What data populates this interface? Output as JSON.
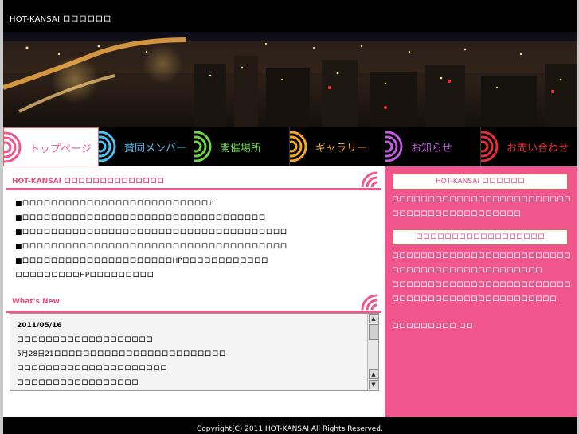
{
  "header": {
    "site_title": "HOT-KANSAI ロロロロロロ"
  },
  "nav": {
    "items": [
      {
        "label": "トップページ",
        "color": "#f0558b",
        "active": true
      },
      {
        "label": "賛同メンバー",
        "color": "#4fc0ef",
        "active": false
      },
      {
        "label": "開催場所",
        "color": "#6fd24a",
        "active": false
      },
      {
        "label": "ギャラリー",
        "color": "#f5a623",
        "active": false
      },
      {
        "label": "お知らせ",
        "color": "#c05ce0",
        "active": false
      },
      {
        "label": "お問い合わせ",
        "color": "#e83030",
        "active": false
      }
    ]
  },
  "intro": {
    "title": "HOT-KANSAI ロロロロロロロロロロロロロロ",
    "lines": [
      "■ロロロロロロロロロロロロロロロロロロロロロロロロロロ♪",
      "■ロロロロロロロロロロロロロロロロロロロロロロロロロロロロロロロロロロ",
      "■ロロロロロロロロロロロロロロロロロロロロロロロロロロロロロロロロロロロロロ",
      "■ロロロロロロロロロロロロロロロロロロロロロロロロロロロロロロロロロロロロロ",
      "■ロロロロロロロロロロロロロロロロロロロロロHPロロロロロロロロロロロロ",
      "ロロロロロロロロロHPロロロロロロロロロ"
    ]
  },
  "whats_new": {
    "title": "What's New",
    "date": "2011/05/16",
    "lines": [
      "ロロロロロロロロロロロロロロロロロロロ",
      "5月28日21ロロロロロロロロロロロロロロロロロロロロロロロロ",
      "ロロロロロロロロロロロロロロロロロロロロロ",
      "ロロロロロロロロロロロロロロロロロ"
    ],
    "scroll_up": "▲",
    "scroll_down": "▼"
  },
  "sidebar": {
    "box1_title": "HOT-KANSAI ロロロロロロ",
    "box1_text": "ロロロロロロロロロロロロロロロロロロロロロロロロロロロロロロロロロロロロロロロロロロロ",
    "box2_title": "ロロロロロロロロロロロロロロロロロロ",
    "box2_text1": "ロロロロロロロロロロロロロロロロロロロロロロロロロロロロロロロロロロロロロロロロロロロロロロ",
    "box2_text2": "ロロロロロロロロロロロロロロロロロロロロロロロロロロロロロロロロロロロロロロロロロロロロロロロロ",
    "signature": "ロロロロロロロロロ ロロ"
  },
  "footer": {
    "copyright": "Copyright(C) 2011 HOT-KANSAI All Rights Reserved."
  },
  "colors": {
    "accent": "#f0558b",
    "rule": "#e85b8a",
    "title_pink": "#e0507a"
  }
}
